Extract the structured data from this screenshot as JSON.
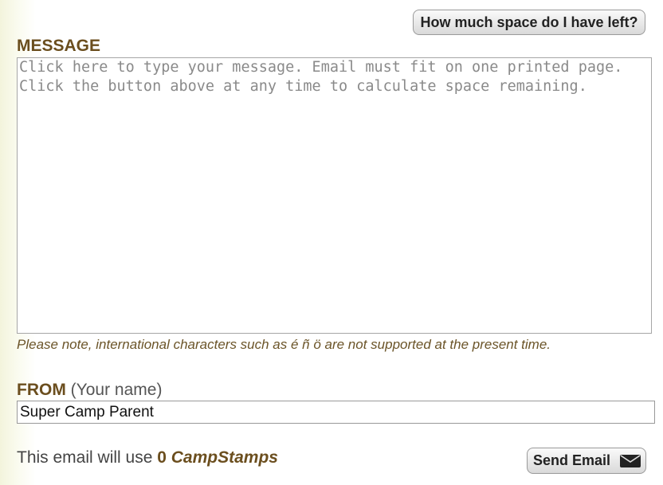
{
  "toolbar": {
    "space_button_label": "How much space do I have left?"
  },
  "message": {
    "label": "MESSAGE",
    "placeholder": "Click here to type your message. Email must fit on one printed page.\nClick the button above at any time to calculate space remaining.",
    "value": ""
  },
  "note": "Please note, international characters such as é ñ ö are not supported at the present time.",
  "from": {
    "label": "FROM",
    "hint": "(Your name)",
    "value": "Super Camp Parent"
  },
  "usage": {
    "prefix": "This email will use",
    "count": "0",
    "unit": "CampStamps"
  },
  "send": {
    "label": "Send Email",
    "icon": "envelope-icon"
  },
  "colors": {
    "accent": "#6b4e1e",
    "note": "#6b5428"
  }
}
